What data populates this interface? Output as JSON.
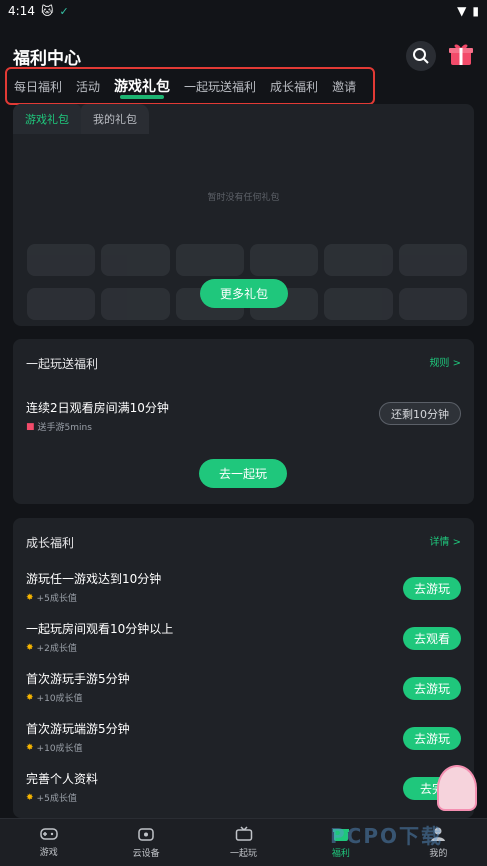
{
  "status": {
    "time": "4:14"
  },
  "header": {
    "title": "福利中心"
  },
  "tabs": [
    "每日福利",
    "活动",
    "游戏礼包",
    "一起玩送福利",
    "成长福利",
    "邀请"
  ],
  "gift": {
    "subtabs": [
      "游戏礼包",
      "我的礼包"
    ],
    "empty_text": "暂时没有任何礼包",
    "more_button": "更多礼包"
  },
  "together": {
    "title": "一起玩送福利",
    "rule_link": "规则 >",
    "task_name": "连续2日观看房间满10分钟",
    "task_reward": "送手游5mins",
    "remain_button": "还剩10分钟",
    "go_button": "去一起玩"
  },
  "growth": {
    "title": "成长福利",
    "detail_link": "详情 >",
    "tasks": [
      {
        "name": "游玩任一游戏达到10分钟",
        "reward": "+5成长值",
        "button": "去游玩"
      },
      {
        "name": "一起玩房间观看10分钟以上",
        "reward": "+2成长值",
        "button": "去观看"
      },
      {
        "name": "首次游玩手游5分钟",
        "reward": "+10成长值",
        "button": "去游玩"
      },
      {
        "name": "首次游玩端游5分钟",
        "reward": "+10成长值",
        "button": "去游玩"
      },
      {
        "name": "完善个人资料",
        "reward": "+5成长值",
        "button": "去完"
      }
    ]
  },
  "nav": [
    "游戏",
    "云设备",
    "一起玩",
    "福利",
    "我的"
  ],
  "watermark": "PCPO下载"
}
